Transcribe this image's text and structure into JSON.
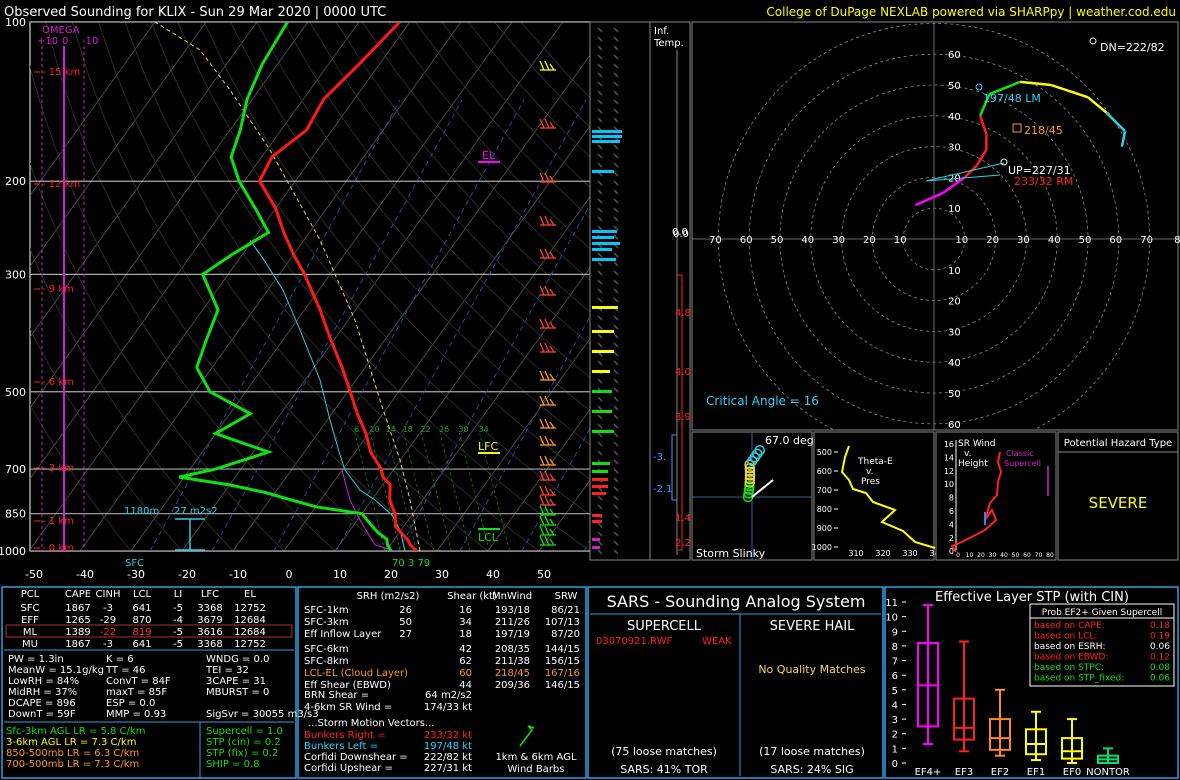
{
  "header": {
    "title": "Observed Sounding for KLIX  -  Sun 29 Mar 2020 | 0000 UTC",
    "credit": "College of DuPage NEXLAB powered via SHARPpy | weather.cod.edu"
  },
  "colors": {
    "temp": "#ff1a1a",
    "dew": "#10e010",
    "virt": "#ff6060",
    "wetbulb": "#30d0e0",
    "parcel": "#e8d840",
    "omega": "#d020d0",
    "accent": "#00c8ff",
    "yellow": "#ffff00",
    "orange": "#ff9a1a"
  },
  "skewt": {
    "pressure_ticks": [
      "100",
      "200",
      "300",
      "500",
      "700",
      "850",
      "1000"
    ],
    "temp_ticks": [
      "-50",
      "-40",
      "-30",
      "-20",
      "-10",
      "0",
      "10",
      "20",
      "30",
      "40",
      "50"
    ],
    "height_labels": [
      "15 km",
      "12 km",
      "9 km",
      "6 km",
      "3 km",
      "1 km",
      "0 km"
    ],
    "omega_title": "OMEGA",
    "omega_ticks": [
      "+10",
      "0",
      "-10"
    ],
    "mix_ratio_labels": [
      "6",
      "10",
      "14",
      "18",
      "22",
      "26",
      "30",
      "34"
    ],
    "el_label": "EL",
    "lfc_label": "LFC",
    "lcl_label": "LCL",
    "sfc_label": "SFC",
    "inflow_depth": "1180m",
    "inflow_srh": "27 m2s2",
    "sfc_values": "70 3 79"
  },
  "chart_data": [
    {
      "type": "line",
      "title": "Observed Sounding for KLIX  -  Sun 29 Mar 2020 | 0000 UTC",
      "xlabel": "",
      "ylabel": "",
      "y_scale": "log pressure (hPa)",
      "ylim": [
        1000,
        100
      ],
      "xlim": [
        -50,
        50
      ],
      "series": [
        {
          "name": "",
          "role": "temperature",
          "p": [
            1000,
            975,
            950,
            925,
            900,
            875,
            850,
            825,
            800,
            775,
            750,
            725,
            700,
            650,
            600,
            550,
            500,
            450,
            400,
            350,
            300,
            275,
            250,
            225,
            200,
            180,
            160,
            140,
            120,
            100
          ],
          "t": [
            26,
            24,
            22.5,
            20.5,
            18.5,
            17.5,
            16.5,
            15,
            13.5,
            12.5,
            11.5,
            9,
            7.5,
            3,
            -0.5,
            -5,
            -9.5,
            -14.5,
            -20.5,
            -27,
            -35,
            -40,
            -45,
            -50,
            -57,
            -58,
            -55,
            -56,
            -54,
            -52
          ]
        },
        {
          "name": "",
          "role": "dewpoint",
          "p": [
            1000,
            975,
            950,
            925,
            900,
            875,
            850,
            825,
            800,
            775,
            750,
            725,
            700,
            650,
            600,
            550,
            500,
            450,
            400,
            350,
            300,
            275,
            250,
            225,
            200,
            180,
            160,
            140,
            120,
            100
          ],
          "t": [
            21,
            19.5,
            18.5,
            16,
            14,
            12,
            10,
            0,
            -6,
            -12,
            -20,
            -31,
            -25,
            -17,
            -30,
            -26,
            -37,
            -43,
            -45,
            -47,
            -55,
            -52,
            -48,
            -54,
            -61,
            -66,
            -68,
            -71,
            -73,
            -74
          ]
        }
      ]
    },
    {
      "type": "line",
      "title": "",
      "xlabel": "",
      "ylabel": "",
      "subtype": "hodograph",
      "rings_kt": [
        10,
        20,
        30,
        40,
        50,
        60,
        70
      ],
      "series": [
        {
          "name": "",
          "role": "hodograph",
          "u": [
            -6,
            3,
            10,
            14,
            17,
            17,
            15,
            18,
            28,
            38,
            50,
            56,
            62,
            61
          ],
          "v": [
            11,
            15,
            20,
            24,
            29,
            34,
            40,
            47,
            51,
            50,
            46,
            41,
            35,
            30
          ]
        }
      ]
    },
    {
      "type": "bar",
      "title": "Effective Layer STP (with CIN)",
      "subtype": "box",
      "categories": [
        "EF4+",
        "EF3",
        "EF2",
        "EF1",
        "EF0",
        "NONTOR"
      ],
      "boxes": [
        {
          "whislo": 1.3,
          "q1": 2.5,
          "med": 5.3,
          "q3": 8.2,
          "whishi": 10.8
        },
        {
          "whislo": 0.8,
          "q1": 1.6,
          "med": 2.4,
          "q3": 4.4,
          "whishi": 8.3
        },
        {
          "whislo": 0.5,
          "q1": 0.9,
          "med": 1.7,
          "q3": 3.0,
          "whishi": 5.0
        },
        {
          "whislo": 0.2,
          "q1": 0.6,
          "med": 1.3,
          "q3": 2.3,
          "whishi": 3.5
        },
        {
          "whislo": 0.0,
          "q1": 0.3,
          "med": 0.8,
          "q3": 1.7,
          "whishi": 3.0
        },
        {
          "whislo": 0.0,
          "q1": 0.0,
          "med": 0.25,
          "q3": 0.5,
          "whishi": 1.0
        }
      ],
      "ylim": [
        0,
        11
      ],
      "yticks": [
        "0",
        "1",
        "2",
        "3",
        "4",
        "5",
        "6",
        "7",
        "8",
        "9",
        "10",
        "11"
      ],
      "box_colors": [
        "#ff00ff",
        "#ff2020",
        "#ff8c1a",
        "#ffff00",
        "#ffff00",
        "#00e070"
      ]
    }
  ],
  "wind_profile": {
    "label_inf": "Inf.",
    "label_temp": "Temp.",
    "values": [
      "0.0",
      "4.8",
      "4.0",
      "3.9",
      "1.4",
      "2.2"
    ],
    "markers": [
      "-3.",
      "-2.1"
    ]
  },
  "hodo": {
    "rings_labels": [
      "60",
      "50",
      "40",
      "30",
      "20",
      "10"
    ],
    "rings_labels_bottom": [
      "10",
      "20",
      "30",
      "40",
      "50",
      "60"
    ],
    "axis_labels": [
      "0",
      "70",
      "60",
      "50",
      "40",
      "30",
      "20",
      "10",
      "10",
      "20",
      "30",
      "40",
      "50",
      "60",
      "70",
      "8"
    ],
    "center_label": "0.0",
    "dn": "DN=222/82",
    "lm": "197/48 LM",
    "mean": "218/45",
    "up": "UP=227/31",
    "rm": "233/32 RM",
    "critical": "Critical Angle = 16"
  },
  "slinky": {
    "deg": "67.0 deg",
    "title": "Storm Slinky"
  },
  "thetae": {
    "title1": "Theta-E",
    "title2": "v.",
    "title3": "Pres",
    "yticks": [
      "500",
      "600",
      "700",
      "800",
      "900",
      "1000"
    ],
    "xticks": [
      "310",
      "320",
      "330",
      "340",
      "35"
    ]
  },
  "srwind": {
    "title1": "SR Wind",
    "title2": "v.",
    "title3": "Height",
    "legend1": "Classic",
    "legend2": "Supercell",
    "yticks": [
      "16",
      "14",
      "12",
      "10",
      "8",
      "6",
      "4",
      "2",
      "0"
    ],
    "xticks": [
      "0",
      "10",
      "20",
      "30",
      "40",
      "50",
      "60",
      "70",
      "80"
    ]
  },
  "hazard": {
    "title": "Potential Hazard Type",
    "value": "SEVERE"
  },
  "parcels": {
    "headers": [
      "PCL",
      "CAPE",
      "CINH",
      "LCL",
      "LI",
      "LFC",
      "EL"
    ],
    "rows": [
      [
        "SFC",
        "1867",
        "-3",
        "641",
        "-5",
        "3368",
        "12752"
      ],
      [
        "EFF",
        "1265",
        "-29",
        "870",
        "-4",
        "3679",
        "12684"
      ],
      [
        "ML",
        "1389",
        "-22",
        "819",
        "-5",
        "3616",
        "12684"
      ],
      [
        "MU",
        "1867",
        "-3",
        "641",
        "-5",
        "3368",
        "12752"
      ]
    ]
  },
  "indices": {
    "col1": [
      "PW = 1.3in",
      "MeanW = 15.1g/kg",
      "LowRH = 84%",
      "MidRH = 37%",
      "DCAPE = 896",
      "DownT = 59F"
    ],
    "col2": [
      "K = 6",
      "TT = 46",
      "ConvT = 84F",
      "maxT = 85F",
      "ESP = 0.0",
      "MMP = 0.93"
    ],
    "col3": [
      "WNDG = 0.0",
      "TEI = 32",
      "3CAPE = 31",
      "MBURST = 0",
      "",
      "SigSvr = 30055 m3/s3"
    ]
  },
  "lapse": [
    "Sfc-3km AGL LR = 5.8 C/km",
    "3-6km AGL LR = 7.3 C/km",
    "850-500mb LR = 6.3 C/km",
    "700-500mb LR = 7.3 C/km"
  ],
  "composite": [
    "Supercell = 1.0",
    "STP (cin) = 0.2",
    "STP (fix) = 0.2",
    "SHIP = 0.8"
  ],
  "kinematics": {
    "headers": [
      "SRH (m2/s2)",
      "Shear (kt)",
      "MnWind",
      "SRW"
    ],
    "rows": [
      [
        "SFC-1km",
        "26",
        "16",
        "193/18",
        "86/21"
      ],
      [
        "SFC-3km",
        "50",
        "34",
        "211/26",
        "107/13"
      ],
      [
        "Eff Inflow Layer",
        "27",
        "18",
        "197/19",
        "87/20"
      ],
      [
        "SFC-6km",
        "42",
        "208/35",
        "144/15",
        ""
      ],
      [
        "SFC-8km",
        "62",
        "211/38",
        "156/15",
        ""
      ],
      [
        "LCL-EL (Cloud Layer)",
        "60",
        "218/45",
        "167/16",
        ""
      ],
      [
        "Eff Shear (EBWD)",
        "44",
        "209/36",
        "146/15",
        ""
      ]
    ],
    "brn": "BRN Shear =",
    "brn_val": "64 m2/s2",
    "sr46": "4-6km SR Wind =",
    "sr46_val": "174/33 kt",
    "vectors_title": "...Storm Motion Vectors...",
    "vectors": [
      [
        "Bunkers Right =",
        "233/32 kt"
      ],
      [
        "Bunkers Left =",
        "197/48 kt"
      ],
      [
        "Corfidi Downshear =",
        "222/82 kt"
      ],
      [
        "Corfidi Upshear =",
        "227/31 kt"
      ]
    ],
    "barb_caption1": "1km & 6km AGL",
    "barb_caption2": "Wind Barbs"
  },
  "sars": {
    "title": "SARS - Sounding Analog System",
    "supercell": "SUPERCELL",
    "hail": "SEVERE HAIL",
    "match_file": "03070921.RWF",
    "match_type": "WEAK",
    "hail_none": "No Quality Matches",
    "loose1": "(75 loose matches)",
    "loose2": "(17 loose matches)",
    "pct1": "SARS: 41% TOR",
    "pct2": "SARS: 24% SIG"
  },
  "stp": {
    "title": "Effective Layer STP (with CIN)",
    "legend_title": "Prob EF2+ Given Supercell",
    "legend": [
      [
        "based on CAPE:",
        "0.18"
      ],
      [
        "based on LCL:",
        "0.19"
      ],
      [
        "based on ESRH:",
        "0.06"
      ],
      [
        "based on EBWD:",
        "0.12"
      ],
      [
        "based on STPC:",
        "0.08"
      ],
      [
        "based on STP_fixed:",
        "0.06"
      ]
    ]
  }
}
